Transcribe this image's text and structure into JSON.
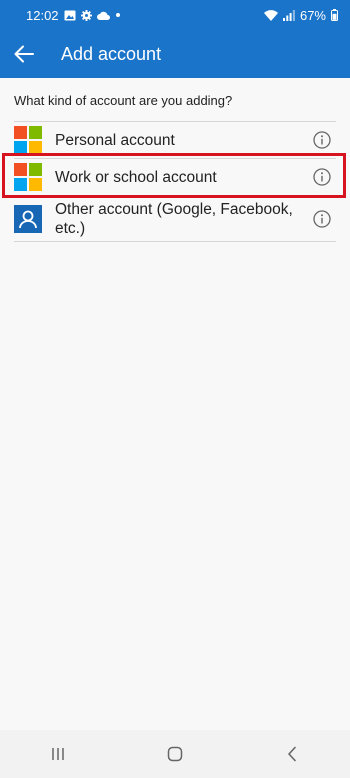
{
  "status_bar": {
    "time": "12:02",
    "battery": "67%",
    "icons_left": [
      "gallery-icon",
      "settings-icon",
      "cloud-icon",
      "dot-icon"
    ],
    "icons_right": [
      "wifi-icon",
      "signal-icon",
      "battery-icon"
    ]
  },
  "app_bar": {
    "title": "Add account",
    "back_icon": "arrow-left-icon",
    "background": "#1a74c9"
  },
  "question": "What kind of account are you adding?",
  "accounts": [
    {
      "label": "Personal account",
      "icon": "microsoft-logo-icon"
    },
    {
      "label": "Work or school account",
      "icon": "microsoft-logo-icon",
      "highlighted": true
    },
    {
      "label": "Other account (Google, Facebook, etc.)",
      "icon": "person-icon"
    }
  ],
  "highlight_color": "#d6131f",
  "nav_bar": {
    "buttons": [
      "recents-icon",
      "home-icon",
      "back-icon"
    ]
  }
}
